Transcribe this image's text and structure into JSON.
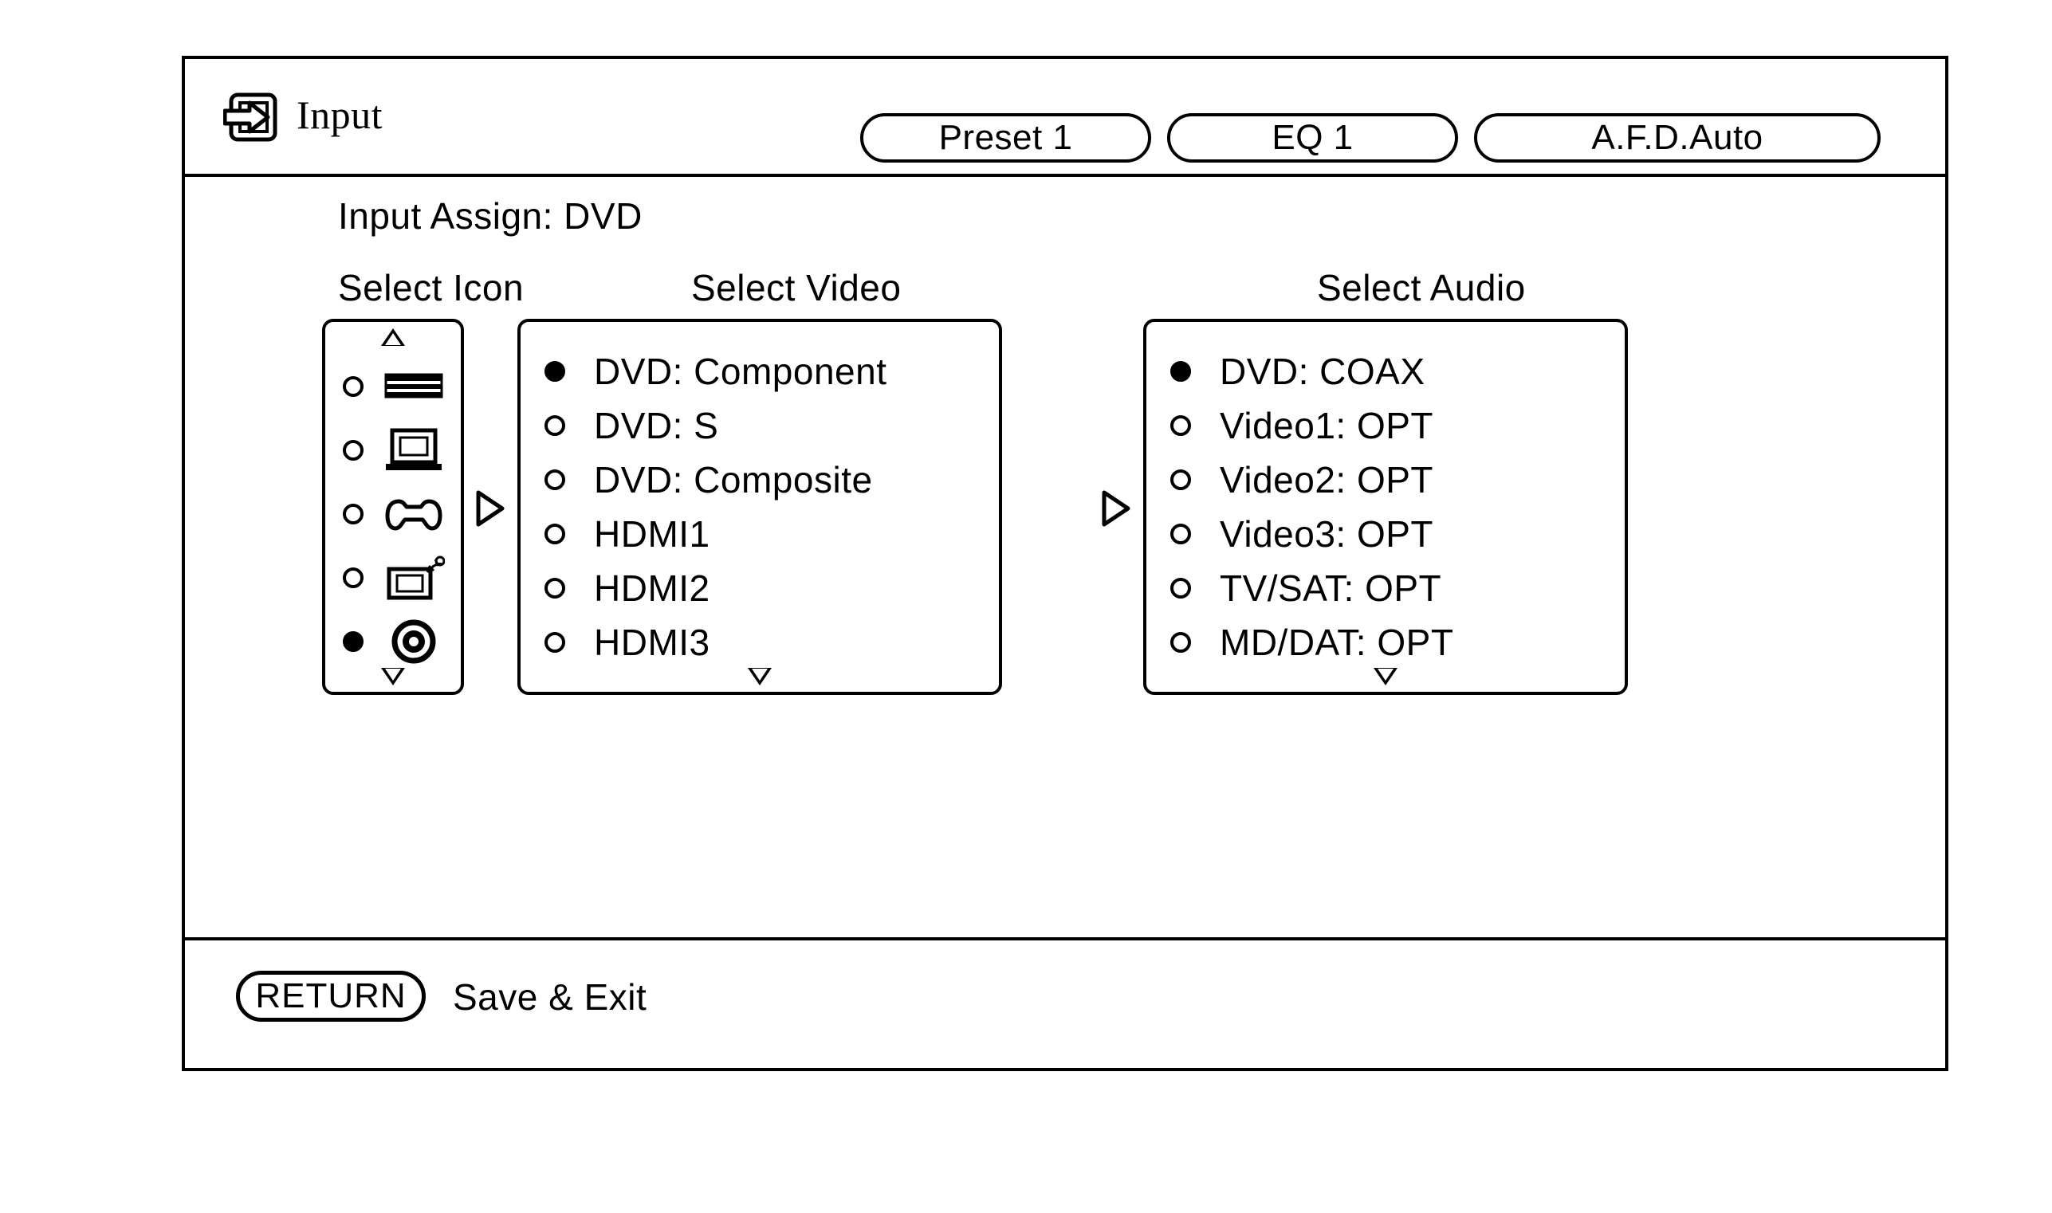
{
  "header": {
    "icon": "input-arrow-icon",
    "title": "Input",
    "buttons": [
      {
        "name": "preset",
        "label": "Preset 1"
      },
      {
        "name": "eq",
        "label": "EQ 1"
      },
      {
        "name": "afd",
        "label": "A.F.D.Auto"
      }
    ]
  },
  "body": {
    "input_assign": "Input Assign: DVD",
    "columns": {
      "icon_header": "Select Icon",
      "video_header": "Select Video",
      "audio_header": "Select Audio"
    },
    "select_icon": {
      "scroll_up": "▲",
      "scroll_down": "▽",
      "items": [
        {
          "icon": "tape-deck-icon",
          "selected": false
        },
        {
          "icon": "monitor-icon",
          "selected": false
        },
        {
          "icon": "game-controller-icon",
          "selected": false
        },
        {
          "icon": "satellite-tv-icon",
          "selected": false
        },
        {
          "icon": "disc-icon",
          "selected": true
        }
      ]
    },
    "select_video": {
      "scroll_down": "▽",
      "items": [
        {
          "label": "DVD: Component",
          "selected": true
        },
        {
          "label": "DVD: S",
          "selected": false
        },
        {
          "label": "DVD: Composite",
          "selected": false
        },
        {
          "label": "HDMI1",
          "selected": false
        },
        {
          "label": "HDMI2",
          "selected": false
        },
        {
          "label": "HDMI3",
          "selected": false
        }
      ]
    },
    "select_audio": {
      "scroll_down": "▽",
      "items": [
        {
          "label": "DVD: COAX",
          "selected": true
        },
        {
          "label": "Video1: OPT",
          "selected": false
        },
        {
          "label": "Video2: OPT",
          "selected": false
        },
        {
          "label": "Video3: OPT",
          "selected": false
        },
        {
          "label": "TV/SAT: OPT",
          "selected": false
        },
        {
          "label": "MD/DAT: OPT",
          "selected": false
        }
      ]
    },
    "separators": [
      "play-arrow-icon",
      "play-arrow-icon"
    ]
  },
  "footer": {
    "return_label": "RETURN",
    "action_label": "Save & Exit"
  },
  "colors": {
    "foreground": "#000000",
    "background": "#ffffff"
  }
}
